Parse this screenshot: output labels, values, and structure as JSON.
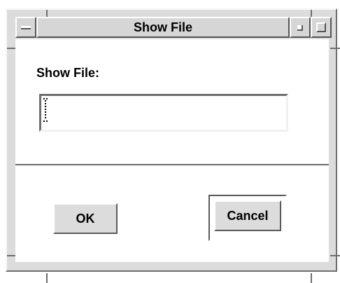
{
  "window": {
    "title": "Show File"
  },
  "dialog": {
    "prompt_label": "Show File:",
    "input_value": "",
    "input_placeholder": ""
  },
  "buttons": {
    "ok_label": "OK",
    "cancel_label": "Cancel"
  },
  "icons": {
    "window_menu": "window-menu-icon",
    "minimize": "minimize-icon",
    "maximize": "maximize-icon",
    "text_cursor": "text-cursor-icon"
  },
  "colors": {
    "chrome": "#d6d6d6",
    "client": "#ffffff",
    "shadow": "#555555",
    "highlight": "#ffffff"
  }
}
